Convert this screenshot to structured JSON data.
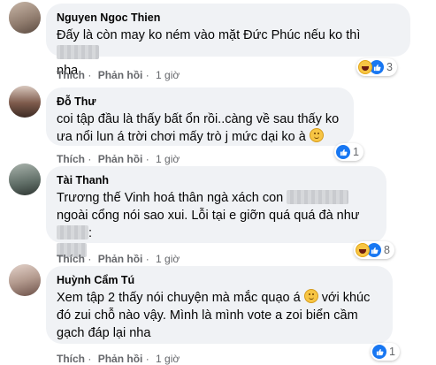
{
  "comments": [
    {
      "author": "Nguyen Ngoc Thien",
      "text_part1": "Đấy là còn may ko ném vào mặt Đức Phúc nếu ko thì",
      "text_part2": "nha",
      "action_like": "Thích",
      "action_reply": "Phản hồi",
      "time": "1 giờ",
      "reactions": [
        "haha",
        "like"
      ],
      "reaction_count": "3"
    },
    {
      "author": "Đỗ Thư",
      "text": "coi tập đầu là thấy bất ổn rồi..càng về sau thấy ko ưa nổi lun á trời chơi mấy trò j mức dại ko à",
      "action_like": "Thích",
      "action_reply": "Phản hồi",
      "time": "1 giờ",
      "reactions": [
        "like"
      ],
      "reaction_count": "1"
    },
    {
      "author": "Tài Thanh",
      "text_part1": "Trương thế Vinh hoá thân ngà xách con",
      "text_part2": "ngoài cổng nói sao xui. Lỗi tại e giỡn quá quá đà như",
      "text_part3": ":",
      "action_like": "Thích",
      "action_reply": "Phản hồi",
      "time": "1 giờ",
      "reactions": [
        "haha",
        "like"
      ],
      "reaction_count": "8"
    },
    {
      "author": "Huỳnh Cẩm Tú",
      "text_part1": "Xem tập 2 thấy nói chuyện mà mắc quạo á",
      "text_part2": "với khúc đó zui chỗ nào vậy. Mình là mình vote a zoi biển cầm gạch đáp lại nha",
      "action_like": "Thích",
      "action_reply": "Phản hồi",
      "time": "1 giờ",
      "reactions": [
        "like"
      ],
      "reaction_count": "1"
    }
  ],
  "colors": {
    "bubble": "#f0f2f5",
    "meta": "#65676b",
    "like_blue": "#1877f2",
    "emoji_yellow": "#f7c544"
  }
}
